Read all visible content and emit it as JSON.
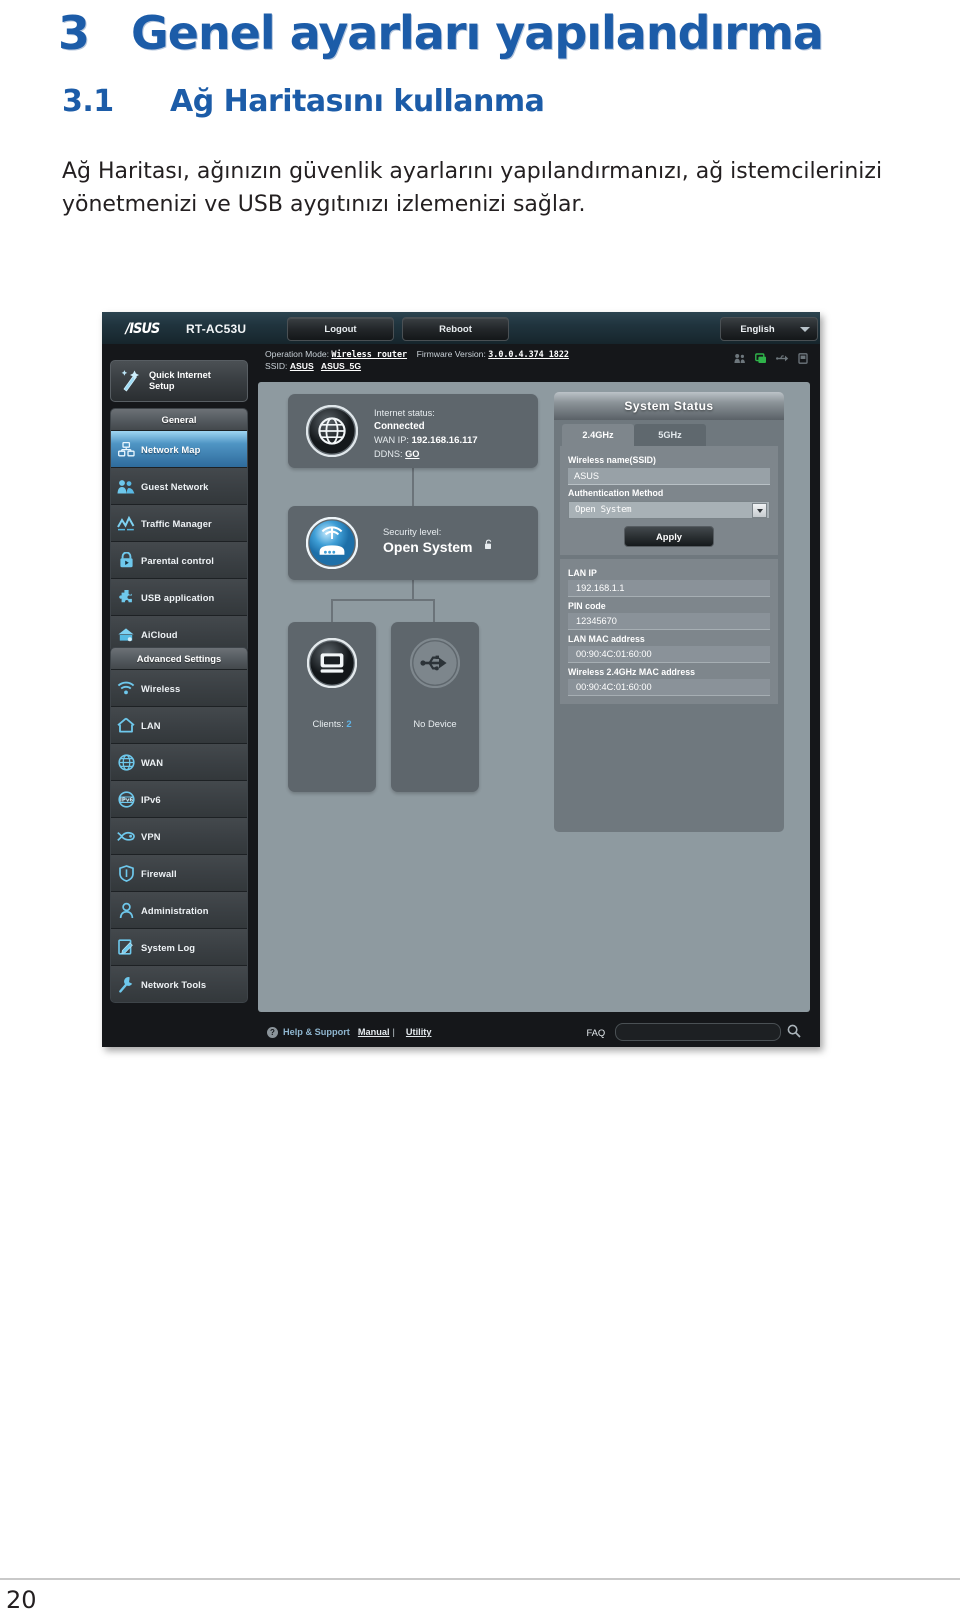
{
  "document": {
    "chapter_number": "3",
    "chapter_title": "Genel ayarları yapılandırma",
    "section_number": "3.1",
    "section_title": "Ağ Haritasını kullanma",
    "paragraph": "Ağ Haritası, ağınızın güvenlik ayarlarını yapılandırmanızı, ağ istemcilerinizi yönetmenizi ve USB aygıtınızı izlemenizi sağlar.",
    "page_number": "20"
  },
  "router_ui": {
    "brand": "/ISUS",
    "model": "RT-AC53U",
    "buttons": {
      "logout": "Logout",
      "reboot": "Reboot",
      "apply": "Apply"
    },
    "language": {
      "selected": "English"
    },
    "info": {
      "operation_mode_label": "Operation Mode:",
      "operation_mode_value": "Wireless_router",
      "firmware_label": "Firmware Version:",
      "firmware_value": "3.0.0.4.374_1822",
      "ssid_label": "SSID:",
      "ssid_values": [
        "ASUS",
        "ASUS_5G"
      ]
    },
    "top_icons": [
      "guest-network-icon",
      "network-map-icon",
      "usb-icon",
      "device-icon"
    ],
    "sidebar": {
      "quick_setup": {
        "label": "Quick Internet Setup",
        "line1": "Quick Internet",
        "line2": "Setup",
        "icon": "magic-wand-icon"
      },
      "groups": [
        {
          "header": "General",
          "items": [
            {
              "label": "Network Map",
              "icon": "network-map-icon",
              "active": true
            },
            {
              "label": "Guest Network",
              "icon": "guest-network-icon",
              "active": false
            },
            {
              "label": "Traffic Manager",
              "icon": "traffic-manager-icon",
              "active": false
            },
            {
              "label": "Parental control",
              "icon": "parental-control-icon",
              "active": false
            },
            {
              "label": "USB application",
              "icon": "usb-application-icon",
              "active": false
            },
            {
              "label": "AiCloud",
              "icon": "aicloud-icon",
              "active": false
            }
          ]
        },
        {
          "header": "Advanced Settings",
          "items": [
            {
              "label": "Wireless",
              "icon": "wifi-icon",
              "active": false
            },
            {
              "label": "LAN",
              "icon": "home-icon",
              "active": false
            },
            {
              "label": "WAN",
              "icon": "globe-icon",
              "active": false
            },
            {
              "label": "IPv6",
              "icon": "ipv6-icon",
              "active": false
            },
            {
              "label": "VPN",
              "icon": "vpn-icon",
              "active": false
            },
            {
              "label": "Firewall",
              "icon": "shield-icon",
              "active": false
            },
            {
              "label": "Administration",
              "icon": "user-icon",
              "active": false
            },
            {
              "label": "System Log",
              "icon": "log-icon",
              "active": false
            },
            {
              "label": "Network Tools",
              "icon": "wrench-icon",
              "active": false
            }
          ]
        }
      ]
    },
    "network_map": {
      "internet": {
        "status_label": "Internet status:",
        "status_value": "Connected",
        "wan_ip_label": "WAN IP:",
        "wan_ip_value": "192.168.16.117",
        "ddns_label": "DDNS:",
        "ddns_link": "GO",
        "icon": "globe-icon"
      },
      "security": {
        "label": "Security level:",
        "value": "Open System",
        "lock_glyph": "unlock-icon",
        "icon": "router-icon"
      },
      "clients": {
        "caption_label": "Clients:",
        "caption_value": "2",
        "icon": "monitor-icon"
      },
      "usb": {
        "caption": "No Device",
        "icon": "usb-icon"
      }
    },
    "system_status": {
      "title": "System Status",
      "tabs": [
        {
          "label": "2.4GHz",
          "selected": true
        },
        {
          "label": "5GHz",
          "selected": false
        }
      ],
      "fields": [
        {
          "label": "Wireless name(SSID)",
          "value": "ASUS",
          "type": "text"
        },
        {
          "label": "Authentication Method",
          "value": "Open System",
          "type": "select"
        }
      ],
      "stats": [
        {
          "label": "LAN IP",
          "value": "192.168.1.1"
        },
        {
          "label": "PIN code",
          "value": "12345670"
        },
        {
          "label": "LAN MAC address",
          "value": "00:90:4C:01:60:00"
        },
        {
          "label": "Wireless 2.4GHz MAC address",
          "value": "00:90:4C:01:60:00"
        }
      ]
    },
    "footer": {
      "help_support": "Help & Support",
      "manual": "Manual",
      "separator": "|",
      "utility": "Utility",
      "faq": "FAQ",
      "search_placeholder": ""
    }
  },
  "colors": {
    "heading_blue": "#1c5ca8",
    "accent_blue": "#5fb4e8",
    "board_gray": "#8e9aa0",
    "panel_dark": "#15171a"
  }
}
